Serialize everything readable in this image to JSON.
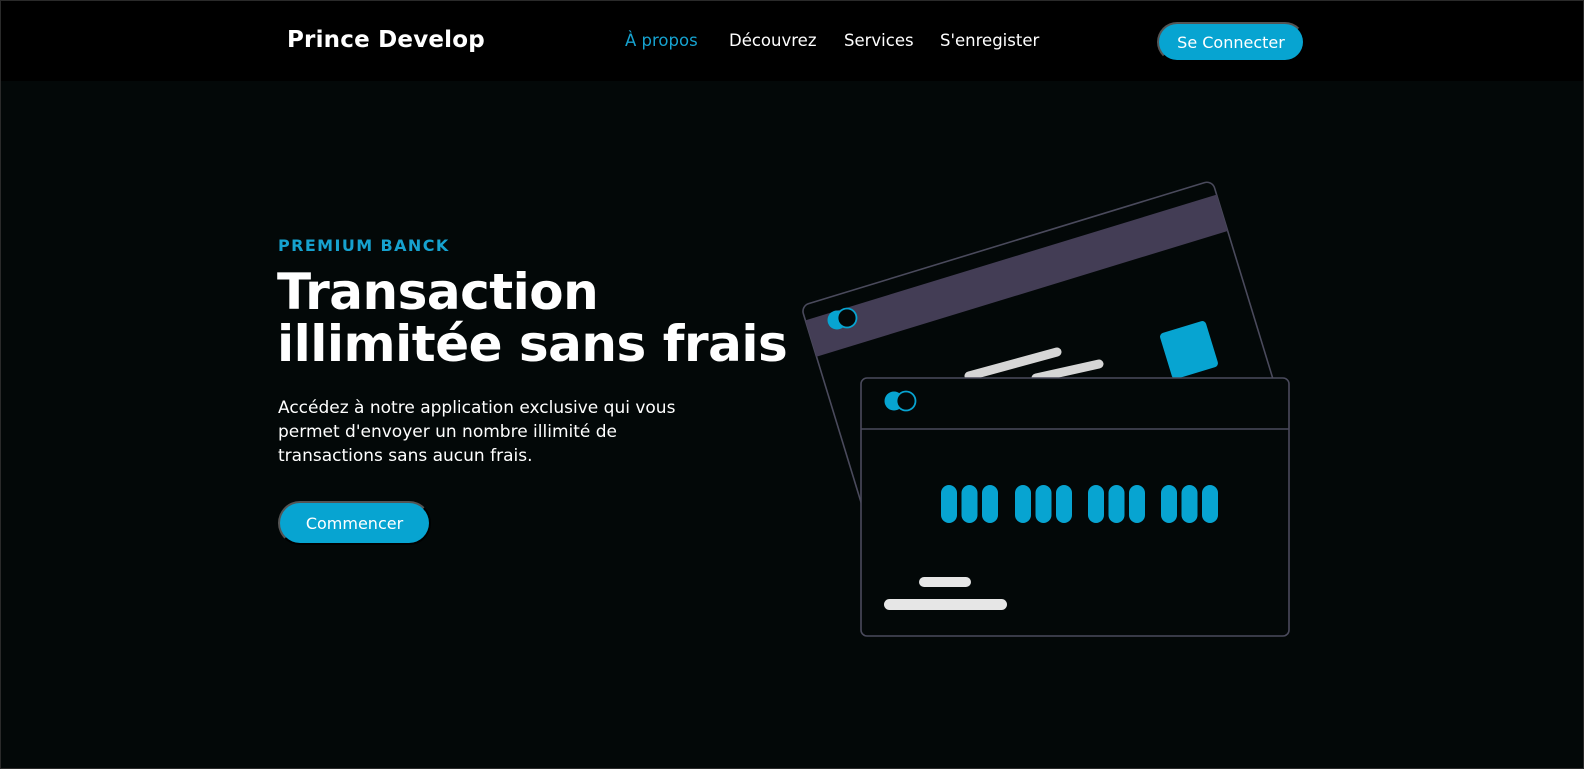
{
  "header": {
    "brand": "Prince Develop",
    "nav": [
      {
        "label": "À propos",
        "active": true
      },
      {
        "label": "Découvrez",
        "active": false
      },
      {
        "label": "Services",
        "active": false
      },
      {
        "label": "S'enregister",
        "active": false
      }
    ],
    "login_label": "Se Connecter"
  },
  "hero": {
    "eyebrow": "PREMIUM BANCK",
    "title_line1": "Transaction",
    "title_line2": "illimitée sans frais",
    "description": "Accédez à notre application exclusive qui vous permet d'envoyer un nombre illimité de transactions sans aucun frais.",
    "cta_label": "Commencer"
  },
  "illustration": {
    "description_icon": "credit-cards-illustration",
    "colors": {
      "accent": "#07a4d1",
      "stripe": "#433d55",
      "outline": "#4a4a5c",
      "placeholder": "#e6e6e6"
    }
  }
}
